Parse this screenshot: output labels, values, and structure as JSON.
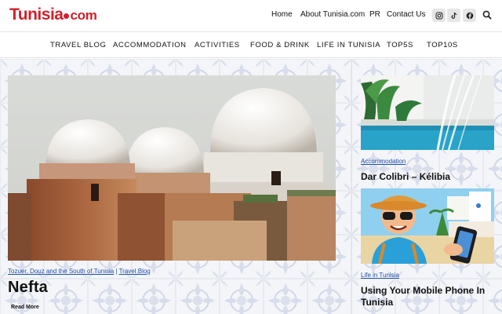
{
  "header": {
    "logo_text": "Tunisia",
    "logo_suffix": "com",
    "brand_color": "#d1202a",
    "top_nav": [
      "Home",
      "About Tunisia.com",
      "PR",
      "Contact Us"
    ],
    "social_icons": [
      "instagram-icon",
      "tiktok-icon",
      "facebook-icon"
    ],
    "search_icon": "search-icon"
  },
  "main_nav": [
    "TRAVEL BLOG",
    "ACCOMMODATION",
    "ACTIVITIES",
    "FOOD & DRINK",
    "LIFE IN TUNISIA",
    "TOP5S",
    "TOP10S"
  ],
  "feature": {
    "categories": [
      "Tozuer, Douz and the South of Tunisia",
      "Travel Blog"
    ],
    "separator": "|",
    "title": "Nefta",
    "read_more": "Read More"
  },
  "sidebar": {
    "posts": [
      {
        "category": "Accommodation",
        "title": "Dar Colibri – Kélibia"
      },
      {
        "category": "Life in Tunisia",
        "title": "Using Your Mobile Phone In Tunisia"
      }
    ]
  },
  "colors": {
    "link": "#1f4fa8",
    "tile_pattern": "#c9cfe0"
  }
}
